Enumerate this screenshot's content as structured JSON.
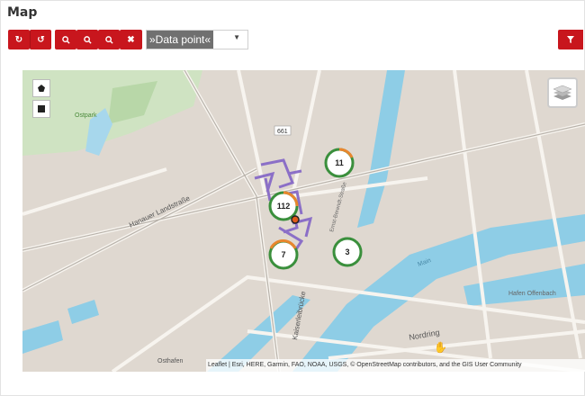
{
  "page": {
    "title": "Map"
  },
  "toolbar": {
    "buttons": [
      {
        "name": "refresh-icon",
        "glyph": "⟲"
      },
      {
        "name": "undo-icon",
        "glyph": "↶"
      },
      {
        "name": "zoom-in-icon",
        "glyph": "🔍︎"
      },
      {
        "name": "zoom-out-icon",
        "glyph": "🔍︎"
      },
      {
        "name": "search-icon",
        "glyph": "🔍︎"
      },
      {
        "name": "close-icon",
        "glyph": "✖"
      }
    ],
    "select_value": "»Data point«",
    "filter_icon": "filter-icon"
  },
  "map": {
    "labels": {
      "street1": "Hanauer Landstraße",
      "street2": "Kaiserleibrücke",
      "street3": "Nordring",
      "park": "Ostpark",
      "area": "Hafen Offenbach",
      "river": "Main",
      "street4": "Osthafen",
      "street5": "Ernst-Berendt-Straße",
      "route": "661"
    },
    "clusters": [
      {
        "count": "11",
        "color": "#2e8b3a"
      },
      {
        "count": "112",
        "color": "#2e8b3a"
      },
      {
        "count": "7",
        "color": "#2e8b3a"
      },
      {
        "count": "3",
        "color": "#2e8b3a"
      }
    ],
    "attribution": "Leaflet | Esri, HERE, Garmin, FAO, NOAA, USGS, © OpenStreetMap contributors, and the GIS User Community"
  }
}
